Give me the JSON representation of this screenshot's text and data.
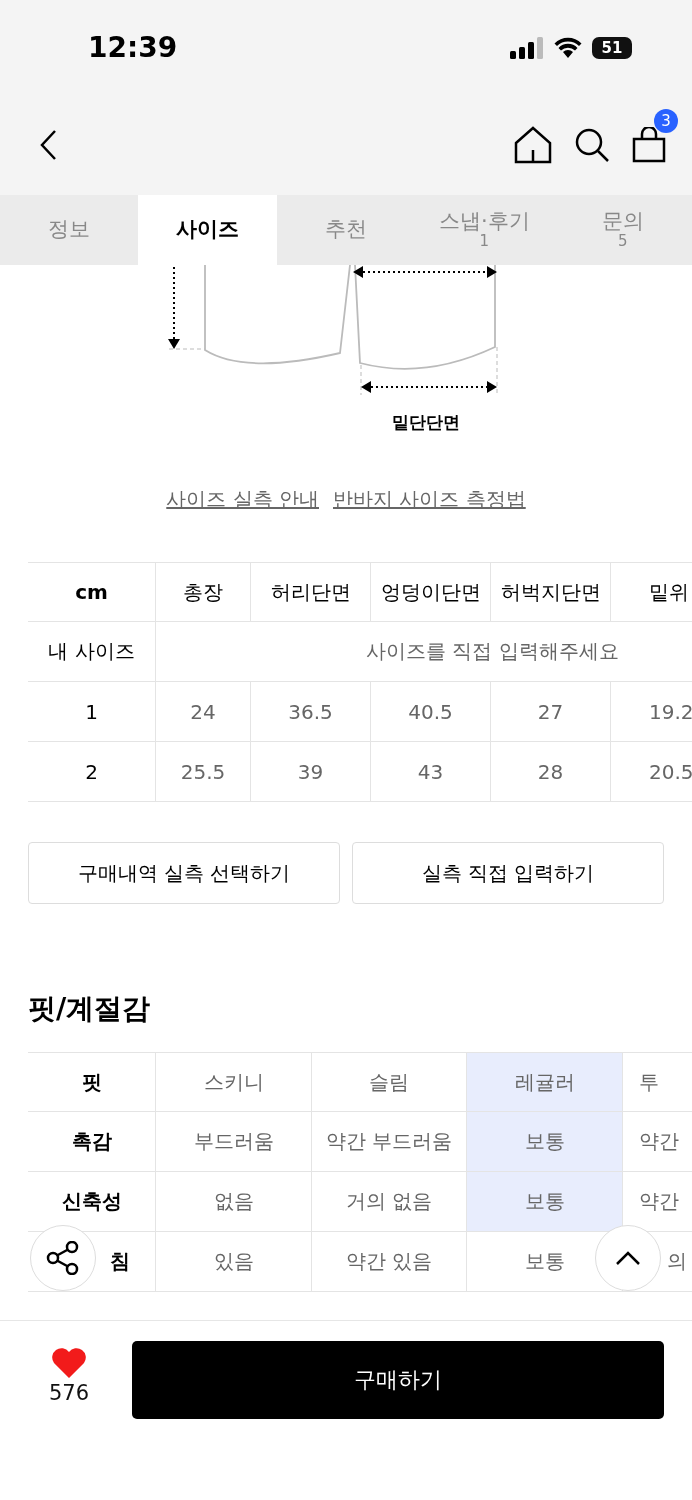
{
  "status_bar": {
    "time": "12:39",
    "battery": "51"
  },
  "nav": {
    "cart_count": "3"
  },
  "tabs": [
    {
      "label": "정보",
      "selected": false
    },
    {
      "label": "사이즈",
      "selected": true
    },
    {
      "label": "추천",
      "selected": false
    },
    {
      "label": "스냅·후기",
      "count": "1",
      "selected": false
    },
    {
      "label": "문의",
      "count": "5",
      "selected": false
    }
  ],
  "diagram": {
    "label": "밑단단면"
  },
  "links": [
    "사이즈 실측 안내",
    "반바지 사이즈 측정법"
  ],
  "size_table": {
    "columns": [
      "cm",
      "총장",
      "허리단면",
      "엉덩이단면",
      "허벅지단면",
      "밑위"
    ],
    "my_size": {
      "label": "내 사이즈",
      "placeholder": "사이즈를 직접 입력해주세요"
    },
    "rows": [
      {
        "cells": [
          "1",
          "24",
          "36.5",
          "40.5",
          "27",
          "19.2"
        ]
      },
      {
        "cells": [
          "2",
          "25.5",
          "39",
          "43",
          "28",
          "20.5"
        ]
      }
    ]
  },
  "actions": [
    "구매내역 실측 선택하기",
    "실측 직접 입력하기"
  ],
  "fit": {
    "title": "핏/계절감",
    "rows": [
      {
        "label": "핏",
        "options": [
          {
            "text": "스키니",
            "selected": false
          },
          {
            "text": "슬림",
            "selected": false
          },
          {
            "text": "레귤러",
            "selected": true
          },
          {
            "text": "투",
            "selected": false
          }
        ]
      },
      {
        "label": "촉감",
        "options": [
          {
            "text": "부드러움",
            "selected": false
          },
          {
            "text": "약간 부드러움",
            "selected": false
          },
          {
            "text": "보통",
            "selected": true
          },
          {
            "text": "약간",
            "selected": false
          }
        ]
      },
      {
        "label": "신축성",
        "options": [
          {
            "text": "없음",
            "selected": false
          },
          {
            "text": "거의 없음",
            "selected": false
          },
          {
            "text": "보통",
            "selected": true
          },
          {
            "text": "약간",
            "selected": false
          }
        ]
      },
      {
        "label": "침",
        "options": [
          {
            "text": "있음",
            "selected": false
          },
          {
            "text": "약간 있음",
            "selected": false
          },
          {
            "text": "보통",
            "selected": false
          },
          {
            "text": "의",
            "selected": false
          }
        ]
      }
    ]
  },
  "bottom_bar": {
    "likes": "576",
    "buy_button": "구매하기"
  }
}
